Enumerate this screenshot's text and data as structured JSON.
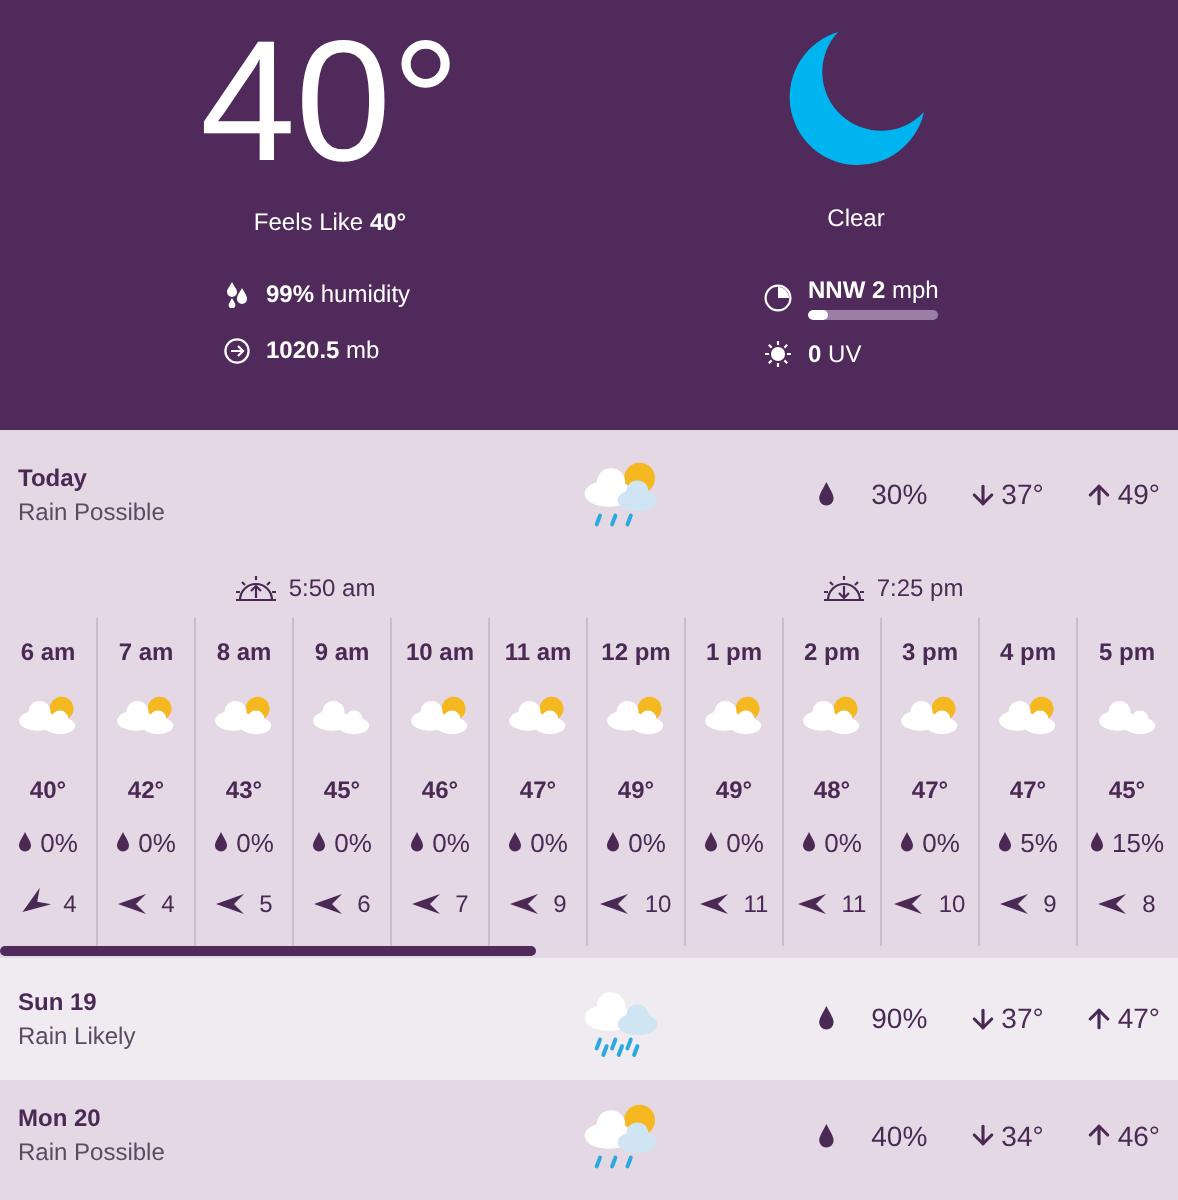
{
  "current": {
    "temperature": "40°",
    "feels_like": "Feels Like **40°**",
    "condition": {
      "kind": "clear-night",
      "text": "Clear"
    },
    "humidity": "**99%** humidity",
    "pressure": "**1020.5** mb",
    "wind": {
      "text": "**NNW 2** mph",
      "level": 0.15
    },
    "uv": "**0** UV"
  },
  "today": {
    "day": "Today",
    "summary": "Rain Possible",
    "kind": "rain-sun",
    "precip": "30%",
    "low": "37°",
    "high": "49°",
    "hours": [
      {
        "time": "6 am",
        "kind": "partly-cloudy",
        "temp": "40°",
        "precip": "0%",
        "wind": {
          "kind": "down-left",
          "speed": "4"
        }
      },
      {
        "time": "7 am",
        "kind": "partly-cloudy",
        "temp": "42°",
        "precip": "0%",
        "wind": {
          "kind": "left",
          "speed": "4"
        }
      },
      {
        "time": "8 am",
        "kind": "partly-cloudy",
        "temp": "43°",
        "precip": "0%",
        "wind": {
          "kind": "left",
          "speed": "5"
        },
        "sun_event": {
          "kind": "sunrise",
          "time": "5:50 am"
        }
      },
      {
        "time": "9 am",
        "kind": "cloudy",
        "temp": "45°",
        "precip": "0%",
        "wind": {
          "kind": "left",
          "speed": "6"
        }
      },
      {
        "time": "10 am",
        "kind": "partly-cloudy",
        "temp": "46°",
        "precip": "0%",
        "wind": {
          "kind": "left",
          "speed": "7"
        }
      },
      {
        "time": "11 am",
        "kind": "partly-cloudy",
        "temp": "47°",
        "precip": "0%",
        "wind": {
          "kind": "left",
          "speed": "9"
        }
      },
      {
        "time": "12 pm",
        "kind": "partly-cloudy",
        "temp": "49°",
        "precip": "0%",
        "wind": {
          "kind": "left",
          "speed": "10"
        }
      },
      {
        "time": "1 pm",
        "kind": "partly-cloudy",
        "temp": "49°",
        "precip": "0%",
        "wind": {
          "kind": "left",
          "speed": "11"
        }
      },
      {
        "time": "2 pm",
        "kind": "partly-cloudy",
        "temp": "48°",
        "precip": "0%",
        "wind": {
          "kind": "left",
          "speed": "11"
        },
        "sun_event": {
          "kind": "sunset",
          "time": "7:25 pm"
        }
      },
      {
        "time": "3 pm",
        "kind": "partly-cloudy",
        "temp": "47°",
        "precip": "0%",
        "wind": {
          "kind": "left",
          "speed": "10"
        }
      },
      {
        "time": "4 pm",
        "kind": "partly-cloudy",
        "temp": "47°",
        "precip": "5%",
        "wind": {
          "kind": "left",
          "speed": "9"
        }
      },
      {
        "time": "5 pm",
        "kind": "cloudy",
        "temp": "45°",
        "precip": "15%",
        "wind": {
          "kind": "left",
          "speed": "8"
        }
      }
    ]
  },
  "days": [
    {
      "day": "Sun 19",
      "summary": "Rain Likely",
      "kind": "rain",
      "precip": "90%",
      "low": "37°",
      "high": "47°",
      "selected": false
    },
    {
      "day": "Mon 20",
      "summary": "Rain Possible",
      "kind": "rain-sun",
      "precip": "40%",
      "low": "34°",
      "high": "46°",
      "selected": true
    }
  ]
}
